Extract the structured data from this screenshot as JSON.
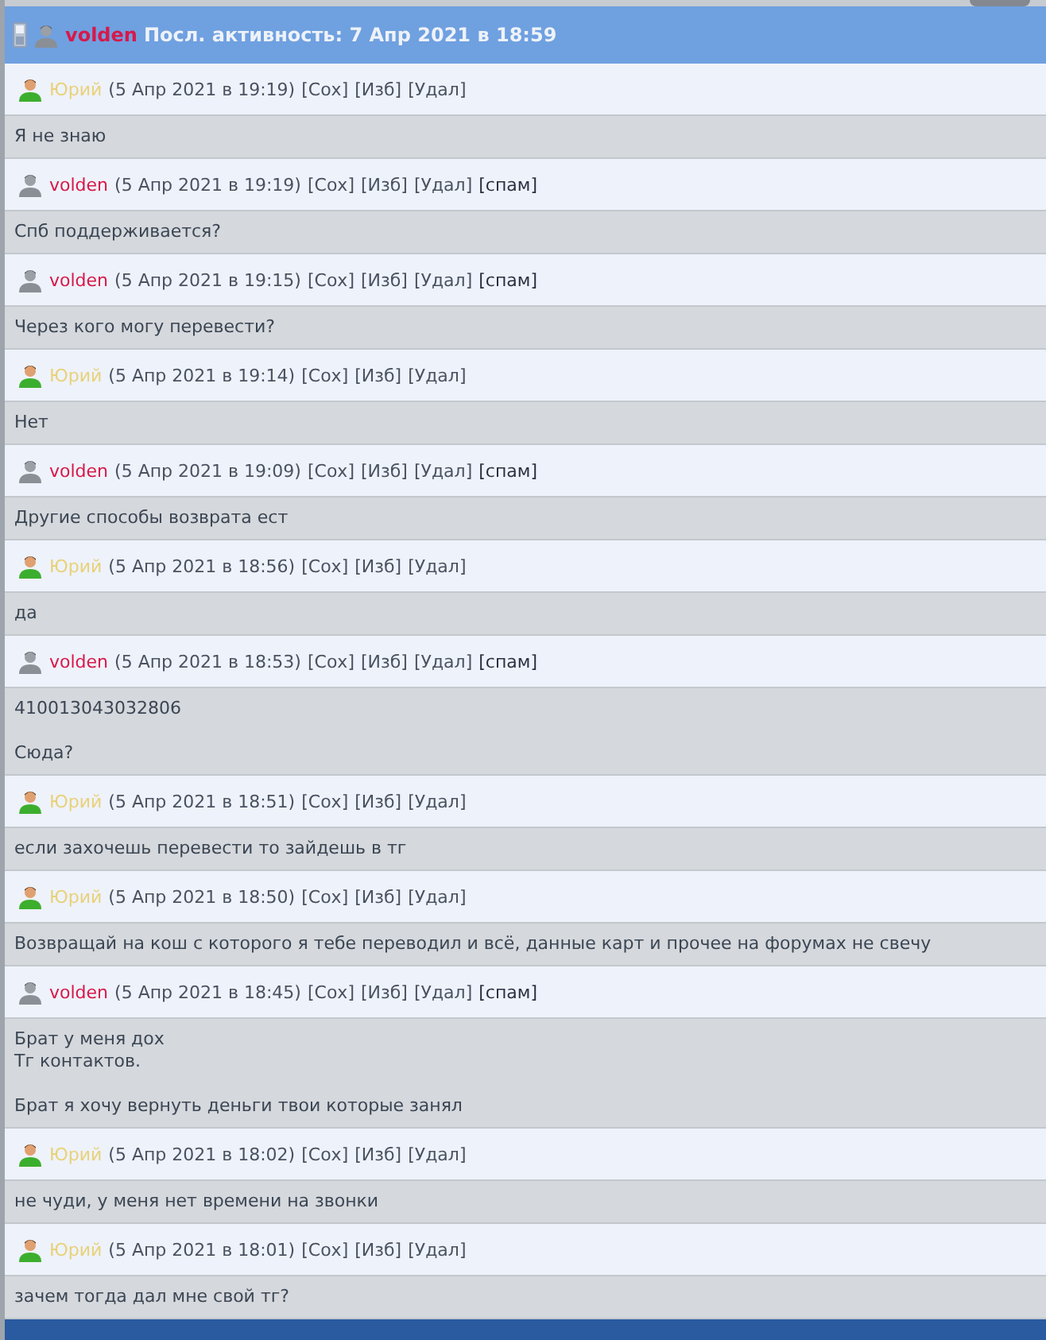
{
  "header": {
    "user": "volden",
    "activity": "Посл. активность: 7 Апр 2021 в 18:59"
  },
  "messages": [
    {
      "kind": "own",
      "author": "Юрий",
      "time": "(5 Апр 2021 в 19:19)",
      "actions": [
        "[Сох]",
        "[Изб]",
        "[Удал]"
      ],
      "body": [
        [
          "Я не знаю"
        ]
      ]
    },
    {
      "kind": "peer",
      "author": "volden",
      "time": "(5 Апр 2021 в 19:19)",
      "actions": [
        "[Сох]",
        "[Изб]",
        "[Удал]",
        "[спам]"
      ],
      "body": [
        [
          "Спб поддерживается?"
        ]
      ]
    },
    {
      "kind": "peer",
      "author": "volden",
      "time": "(5 Апр 2021 в 19:15)",
      "actions": [
        "[Сох]",
        "[Изб]",
        "[Удал]",
        "[спам]"
      ],
      "body": [
        [
          "Через кого могу перевести?"
        ]
      ]
    },
    {
      "kind": "own",
      "author": "Юрий",
      "time": "(5 Апр 2021 в 19:14)",
      "actions": [
        "[Сох]",
        "[Изб]",
        "[Удал]"
      ],
      "body": [
        [
          "Нет"
        ]
      ]
    },
    {
      "kind": "peer",
      "author": "volden",
      "time": "(5 Апр 2021 в 19:09)",
      "actions": [
        "[Сох]",
        "[Изб]",
        "[Удал]",
        "[спам]"
      ],
      "body": [
        [
          "Другие способы возврата ест"
        ]
      ]
    },
    {
      "kind": "own",
      "author": "Юрий",
      "time": "(5 Апр 2021 в 18:56)",
      "actions": [
        "[Сох]",
        "[Изб]",
        "[Удал]"
      ],
      "body": [
        [
          "да"
        ]
      ]
    },
    {
      "kind": "peer",
      "author": "volden",
      "time": "(5 Апр 2021 в 18:53)",
      "actions": [
        "[Сох]",
        "[Изб]",
        "[Удал]",
        "[спам]"
      ],
      "body": [
        [
          "410013043032806"
        ],
        [
          "Сюда?"
        ]
      ]
    },
    {
      "kind": "own",
      "author": "Юрий",
      "time": "(5 Апр 2021 в 18:51)",
      "actions": [
        "[Сох]",
        "[Изб]",
        "[Удал]"
      ],
      "body": [
        [
          "если захочешь перевести то зайдешь в тг"
        ]
      ]
    },
    {
      "kind": "own",
      "author": "Юрий",
      "time": "(5 Апр 2021 в 18:50)",
      "actions": [
        "[Сох]",
        "[Изб]",
        "[Удал]"
      ],
      "body": [
        [
          "Возвращай на кош с которого я тебе переводил и всё, данные карт и прочее на форумах не свечу"
        ]
      ]
    },
    {
      "kind": "peer",
      "author": "volden",
      "time": "(5 Апр 2021 в 18:45)",
      "actions": [
        "[Сох]",
        "[Изб]",
        "[Удал]",
        "[спам]"
      ],
      "body": [
        [
          "Брат у меня дох",
          "Тг контактов."
        ],
        [
          "Брат я хочу вернуть деньги твои которые занял"
        ]
      ]
    },
    {
      "kind": "own",
      "author": "Юрий",
      "time": "(5 Апр 2021 в 18:02)",
      "actions": [
        "[Сох]",
        "[Изб]",
        "[Удал]"
      ],
      "body": [
        [
          "не чуди, у меня нет времени на звонки"
        ]
      ]
    },
    {
      "kind": "own",
      "author": "Юрий",
      "time": "(5 Апр 2021 в 18:01)",
      "actions": [
        "[Сох]",
        "[Изб]",
        "[Удал]"
      ],
      "body": [
        [
          "зачем тогда дал мне свой тг?"
        ]
      ]
    }
  ]
}
